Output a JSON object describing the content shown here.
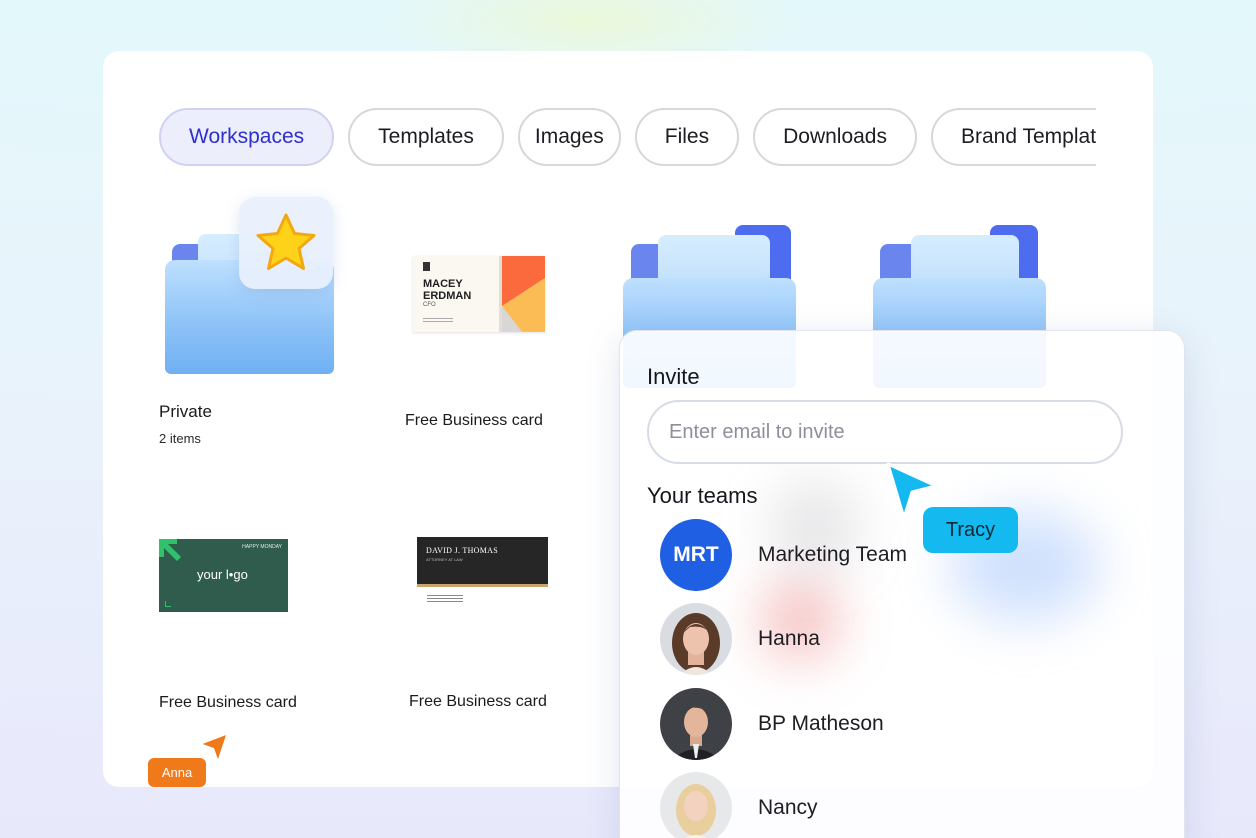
{
  "tabs": [
    {
      "label": "Workspaces",
      "active": true
    },
    {
      "label": "Templates",
      "active": false
    },
    {
      "label": "Images",
      "active": false
    },
    {
      "label": "Files",
      "active": false
    },
    {
      "label": "Downloads",
      "active": false
    },
    {
      "label": "Brand Templates",
      "active": false
    }
  ],
  "items": {
    "private_folder": {
      "title": "Private",
      "count": "2 items",
      "icon": "star-icon"
    },
    "card_macey": {
      "title": "Free Business card",
      "name_line1": "MACEY",
      "name_line2": "ERDMAN",
      "role": "CFO"
    },
    "card_logo": {
      "title": "Free Business card",
      "tagline": "HAPPY MONDAY",
      "logo_text": "your l•go"
    },
    "card_david": {
      "title": "Free Business card",
      "name": "DAVID J. THOMAS",
      "role": "ATTORNEY AT LAW"
    }
  },
  "invite": {
    "title": "Invite",
    "email_placeholder": "Enter email to invite",
    "teams_title": "Your teams",
    "members": [
      {
        "name": "Marketing Team",
        "initials": "MRT",
        "avatar": "team-initials"
      },
      {
        "name": "Hanna",
        "avatar": "photo"
      },
      {
        "name": "BP Matheson",
        "avatar": "photo"
      },
      {
        "name": "Nancy",
        "avatar": "photo"
      }
    ]
  },
  "collaborators": [
    {
      "name": "Tracy",
      "color": "#14b9f0"
    },
    {
      "name": "Anna",
      "color": "#f07a1a"
    }
  ],
  "colors": {
    "active_tab_text": "#2f2fcf",
    "active_tab_bg": "#eceefb",
    "team_avatar": "#1f5fe4",
    "folder_front": "#8ec3f7",
    "folder_back": "#6a86ee"
  }
}
